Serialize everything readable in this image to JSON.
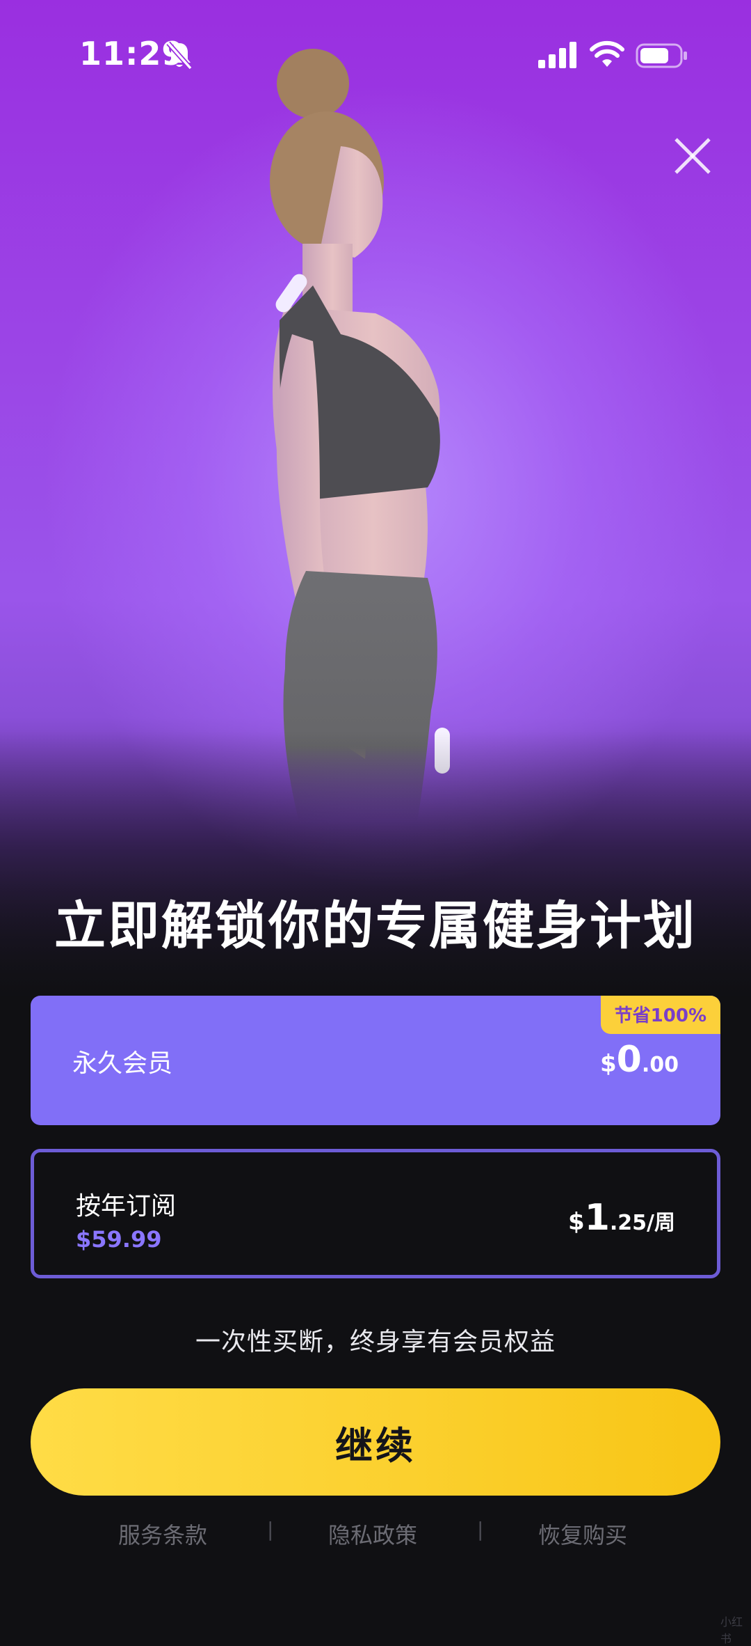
{
  "status_bar": {
    "time": "11:29",
    "icons": [
      "bell-slash-icon",
      "cellular-signal-icon",
      "wifi-icon",
      "battery-icon"
    ]
  },
  "headline": "立即解锁你的专属健身计划",
  "plans": [
    {
      "name": "永久会员",
      "badge": "节省100%",
      "price_currency": "$",
      "price_main": "0",
      "price_fraction": ".00",
      "price_suffix": "",
      "selected": true
    },
    {
      "name": "按年订阅",
      "subtitle": "$59.99",
      "price_currency": "$",
      "price_main": "1",
      "price_fraction": ".25",
      "price_suffix": "/周",
      "selected": false
    }
  ],
  "note": "一次性买断，终身享有会员权益",
  "cta_label": "继续",
  "footer": {
    "terms": "服务条款",
    "privacy": "隐私政策",
    "restore": "恢复购买",
    "separator": "|"
  },
  "watermark": "小红书",
  "colors": {
    "accent_purple": "#816ff7",
    "cta_yellow": "#fcd03a",
    "background": "#101013"
  }
}
